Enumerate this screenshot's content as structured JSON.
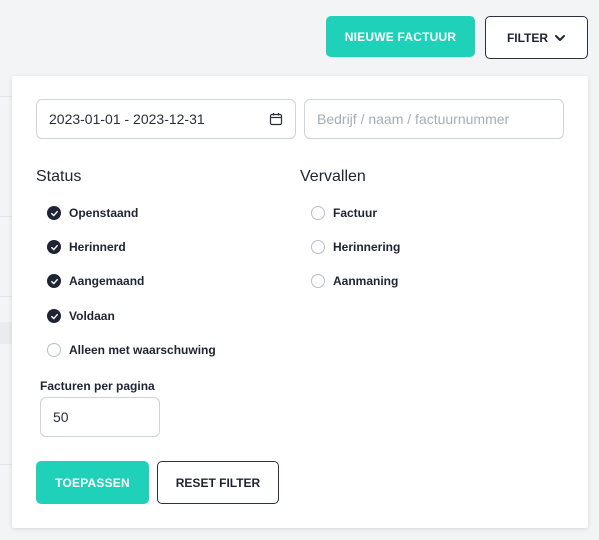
{
  "header": {
    "new_invoice_label": "NIEUWE FACTUUR",
    "filter_label": "FILTER",
    "filter_icon": "chevron-down-icon"
  },
  "filter_panel": {
    "date_range": "2023-01-01 - 2023-12-31",
    "date_icon": "calendar-icon",
    "search_placeholder": "Bedrijf / naam / factuurnummer",
    "status": {
      "title": "Status",
      "items": [
        {
          "label": "Openstaand",
          "checked": true
        },
        {
          "label": "Herinnerd",
          "checked": true
        },
        {
          "label": "Aangemaand",
          "checked": true
        },
        {
          "label": "Voldaan",
          "checked": true
        },
        {
          "label": "Alleen met waarschuwing",
          "checked": false
        }
      ]
    },
    "vervallen": {
      "title": "Vervallen",
      "items": [
        {
          "label": "Factuur",
          "checked": false
        },
        {
          "label": "Herinnering",
          "checked": false
        },
        {
          "label": "Aanmaning",
          "checked": false
        }
      ]
    },
    "per_page_label": "Facturen per pagina",
    "per_page_value": "50",
    "apply_label": "TOEPASSEN",
    "reset_label": "RESET FILTER"
  },
  "colors": {
    "accent": "#1fd1b8",
    "dark": "#1e2433",
    "background": "#f3f4f6"
  }
}
